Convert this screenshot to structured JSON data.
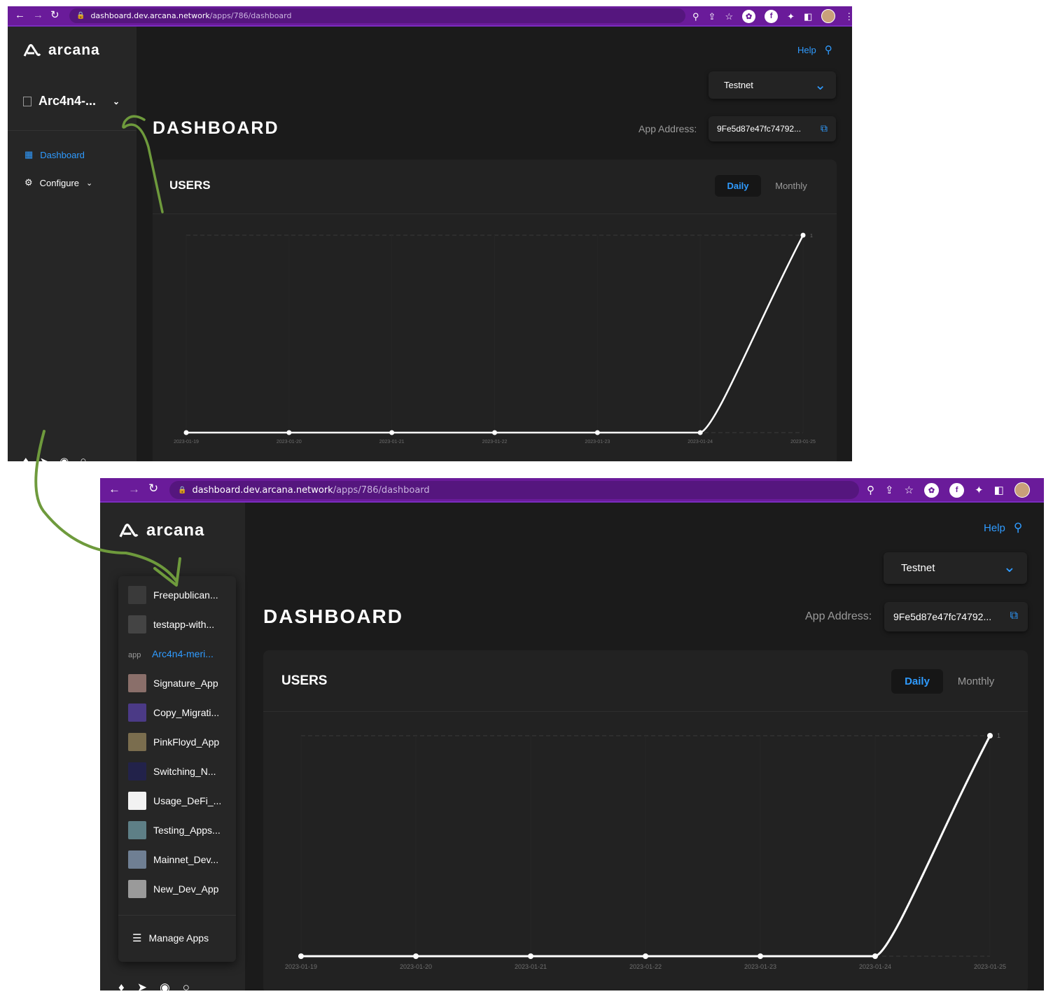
{
  "browser": {
    "url_domain": "dashboard.dev.arcana.network",
    "url_path": "/apps/786/dashboard"
  },
  "brand": {
    "name": "arcana"
  },
  "sidebar": {
    "app_switcher": "Arc4n4-...",
    "items": [
      {
        "label": "Dashboard",
        "icon": "grid-icon",
        "active": true
      },
      {
        "label": "Configure",
        "icon": "gear-icon",
        "active": false
      }
    ]
  },
  "header": {
    "help": "Help",
    "network": "Testnet",
    "page_title": "DASHBOARD",
    "app_address_label": "App Address:",
    "app_address": "9Fe5d87e47fc74792..."
  },
  "users_card": {
    "title": "USERS",
    "toggle": [
      "Daily",
      "Monthly"
    ],
    "active_toggle": "Daily"
  },
  "app_menu": {
    "items": [
      {
        "label": "Freepublican...",
        "color": "#3a3a3a"
      },
      {
        "label": "testapp-with...",
        "color": "#444444"
      },
      {
        "label": "Arc4n4-meri...",
        "color": "",
        "selected": true,
        "alt": "app"
      },
      {
        "label": "Signature_App",
        "color": "#8a6f6a"
      },
      {
        "label": "Copy_Migrati...",
        "color": "#4b3a86"
      },
      {
        "label": "PinkFloyd_App",
        "color": "#7a6d4e"
      },
      {
        "label": "Switching_N...",
        "color": "#22224a"
      },
      {
        "label": "Usage_DeFi_...",
        "color": "#f2f2f2"
      },
      {
        "label": "Testing_Apps...",
        "color": "#5e7f86"
      },
      {
        "label": "Mainnet_Dev...",
        "color": "#6f7f93"
      },
      {
        "label": "New_Dev_App",
        "color": "#9a9a9a"
      }
    ],
    "manage": "Manage Apps"
  },
  "colors": {
    "accent": "#2f9bff",
    "bg": "#1b1b1b",
    "browser": "#6a1b9a",
    "annotation": "#6e9a3c"
  },
  "chart_data": {
    "type": "line",
    "x": [
      "2023-01-19",
      "2023-01-20",
      "2023-01-21",
      "2023-01-22",
      "2023-01-23",
      "2023-01-24",
      "2023-01-25"
    ],
    "values": [
      0,
      0,
      0,
      0,
      0,
      0,
      1
    ],
    "ylim": [
      0,
      1
    ],
    "y_tick_labels": [
      "1"
    ],
    "grid": true
  }
}
